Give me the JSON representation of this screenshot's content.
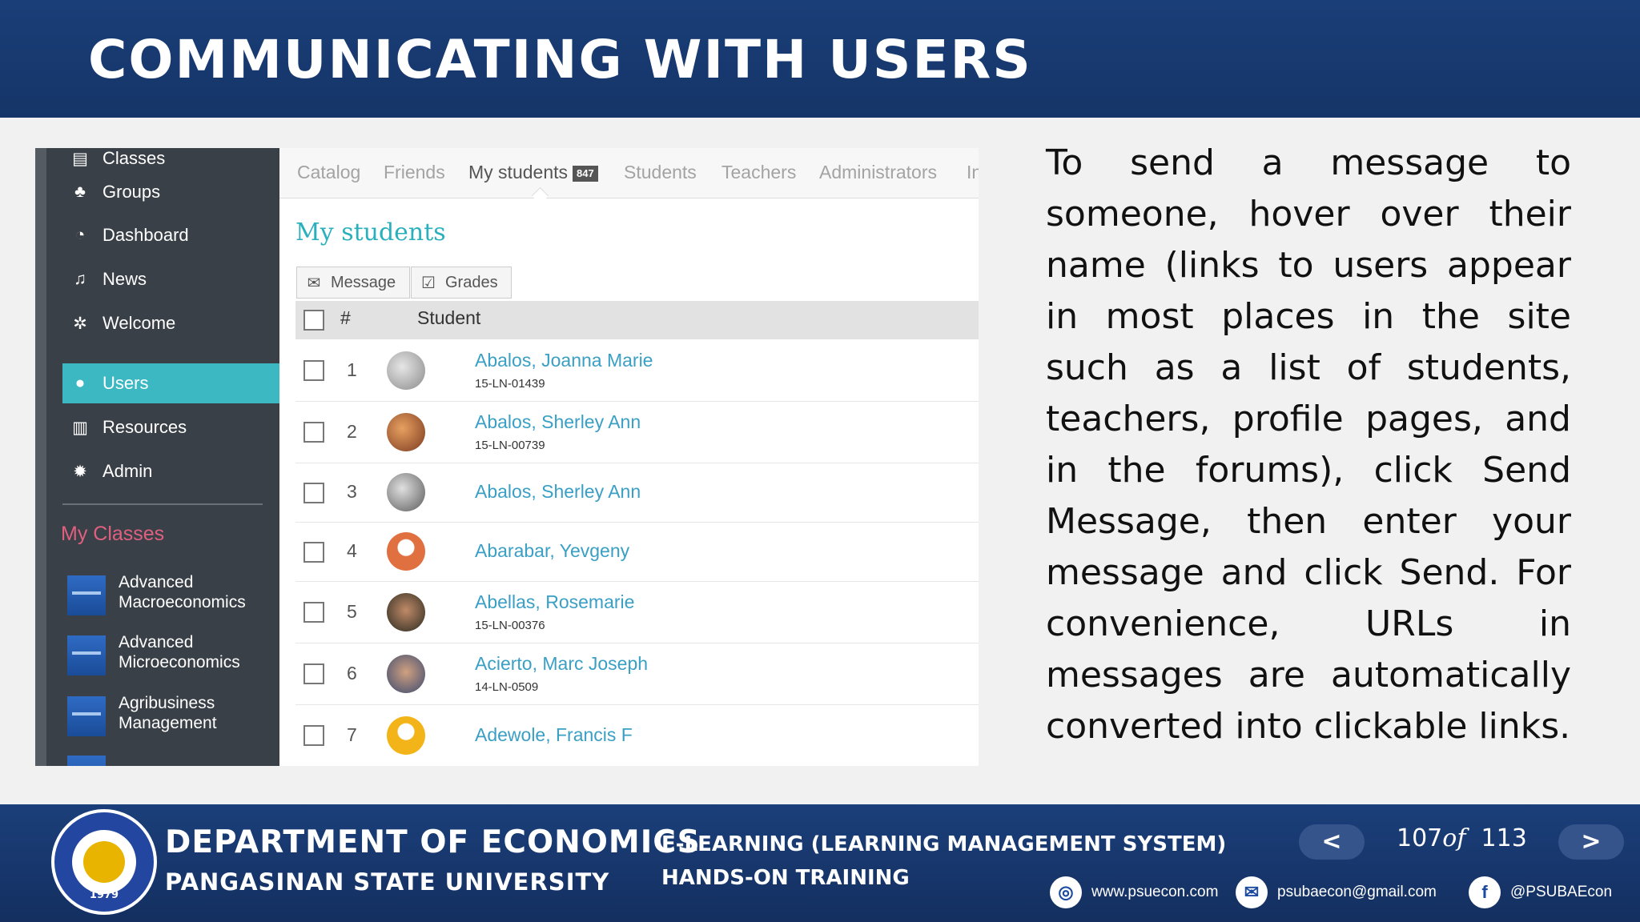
{
  "slide": {
    "title": "COMMUNICATING WITH USERS"
  },
  "sidebar": {
    "items": [
      {
        "label": "Classes",
        "icon": "book-icon",
        "glyph": "▤"
      },
      {
        "label": "Groups",
        "icon": "users-group-icon",
        "glyph": "♣"
      },
      {
        "label": "Dashboard",
        "icon": "dashboard-icon",
        "glyph": "◔"
      },
      {
        "label": "News",
        "icon": "bell-icon",
        "glyph": "♫"
      },
      {
        "label": "Welcome",
        "icon": "sparkle-icon",
        "glyph": "✲"
      },
      {
        "label": "Users",
        "icon": "user-icon",
        "glyph": "●",
        "active": true
      },
      {
        "label": "Resources",
        "icon": "library-icon",
        "glyph": "▥"
      },
      {
        "label": "Admin",
        "icon": "gear-icon",
        "glyph": "✹"
      }
    ],
    "section_title": "My Classes",
    "classes": [
      {
        "line1": "Advanced",
        "line2": "Macroeconomics"
      },
      {
        "line1": "Advanced",
        "line2": "Microeconomics"
      },
      {
        "line1": "Agribusiness",
        "line2": "Management"
      }
    ]
  },
  "tabs": [
    {
      "label": "Catalog"
    },
    {
      "label": "Friends"
    },
    {
      "label": "My students",
      "badge": "847",
      "active": true
    },
    {
      "label": "Students"
    },
    {
      "label": "Teachers"
    },
    {
      "label": "Administrators"
    },
    {
      "label": "In"
    }
  ],
  "main": {
    "heading": "My students",
    "buttons": {
      "message": "Message",
      "grades": "Grades"
    },
    "table": {
      "columns": {
        "num": "#",
        "student": "Student"
      },
      "rows": [
        {
          "num": "1",
          "name": "Abalos, Joanna Marie",
          "id": "15-LN-01439"
        },
        {
          "num": "2",
          "name": "Abalos, Sherley Ann",
          "id": "15-LN-00739"
        },
        {
          "num": "3",
          "name": "Abalos, Sherley Ann",
          "id": ""
        },
        {
          "num": "4",
          "name": "Abarabar, Yevgeny",
          "id": ""
        },
        {
          "num": "5",
          "name": "Abellas, Rosemarie",
          "id": "15-LN-00376"
        },
        {
          "num": "6",
          "name": "Acierto, Marc Joseph",
          "id": "14-LN-0509"
        },
        {
          "num": "7",
          "name": "Adewole, Francis F",
          "id": ""
        }
      ]
    }
  },
  "body_text": "To send a message to someone, hover over their name (links to users appear in most places in the site such as a list of students, teachers, profile pages, and in the forums), click Send Message, then enter your message and click Send. For convenience, URLs in messages are automatically converted into clickable links.",
  "footer": {
    "dept": "DEPARTMENT OF ECONOMICS",
    "univ": "PANGASINAN STATE UNIVERSITY",
    "elearn": "E-LEARNING (LEARNING MANAGEMENT SYSTEM)",
    "handson": "HANDS-ON TRAINING",
    "seal_year": "1979",
    "page_current": "107",
    "page_of": "of",
    "page_total": "113",
    "prev": "<",
    "next": ">",
    "website": "www.psuecon.com",
    "email": "psubaecon@gmail.com",
    "facebook": "@PSUBAEcon"
  },
  "colors": {
    "header": "#1a3e78",
    "accent": "#3cb8c3",
    "link": "#3a9fc4",
    "my_classes": "#e0607f"
  }
}
